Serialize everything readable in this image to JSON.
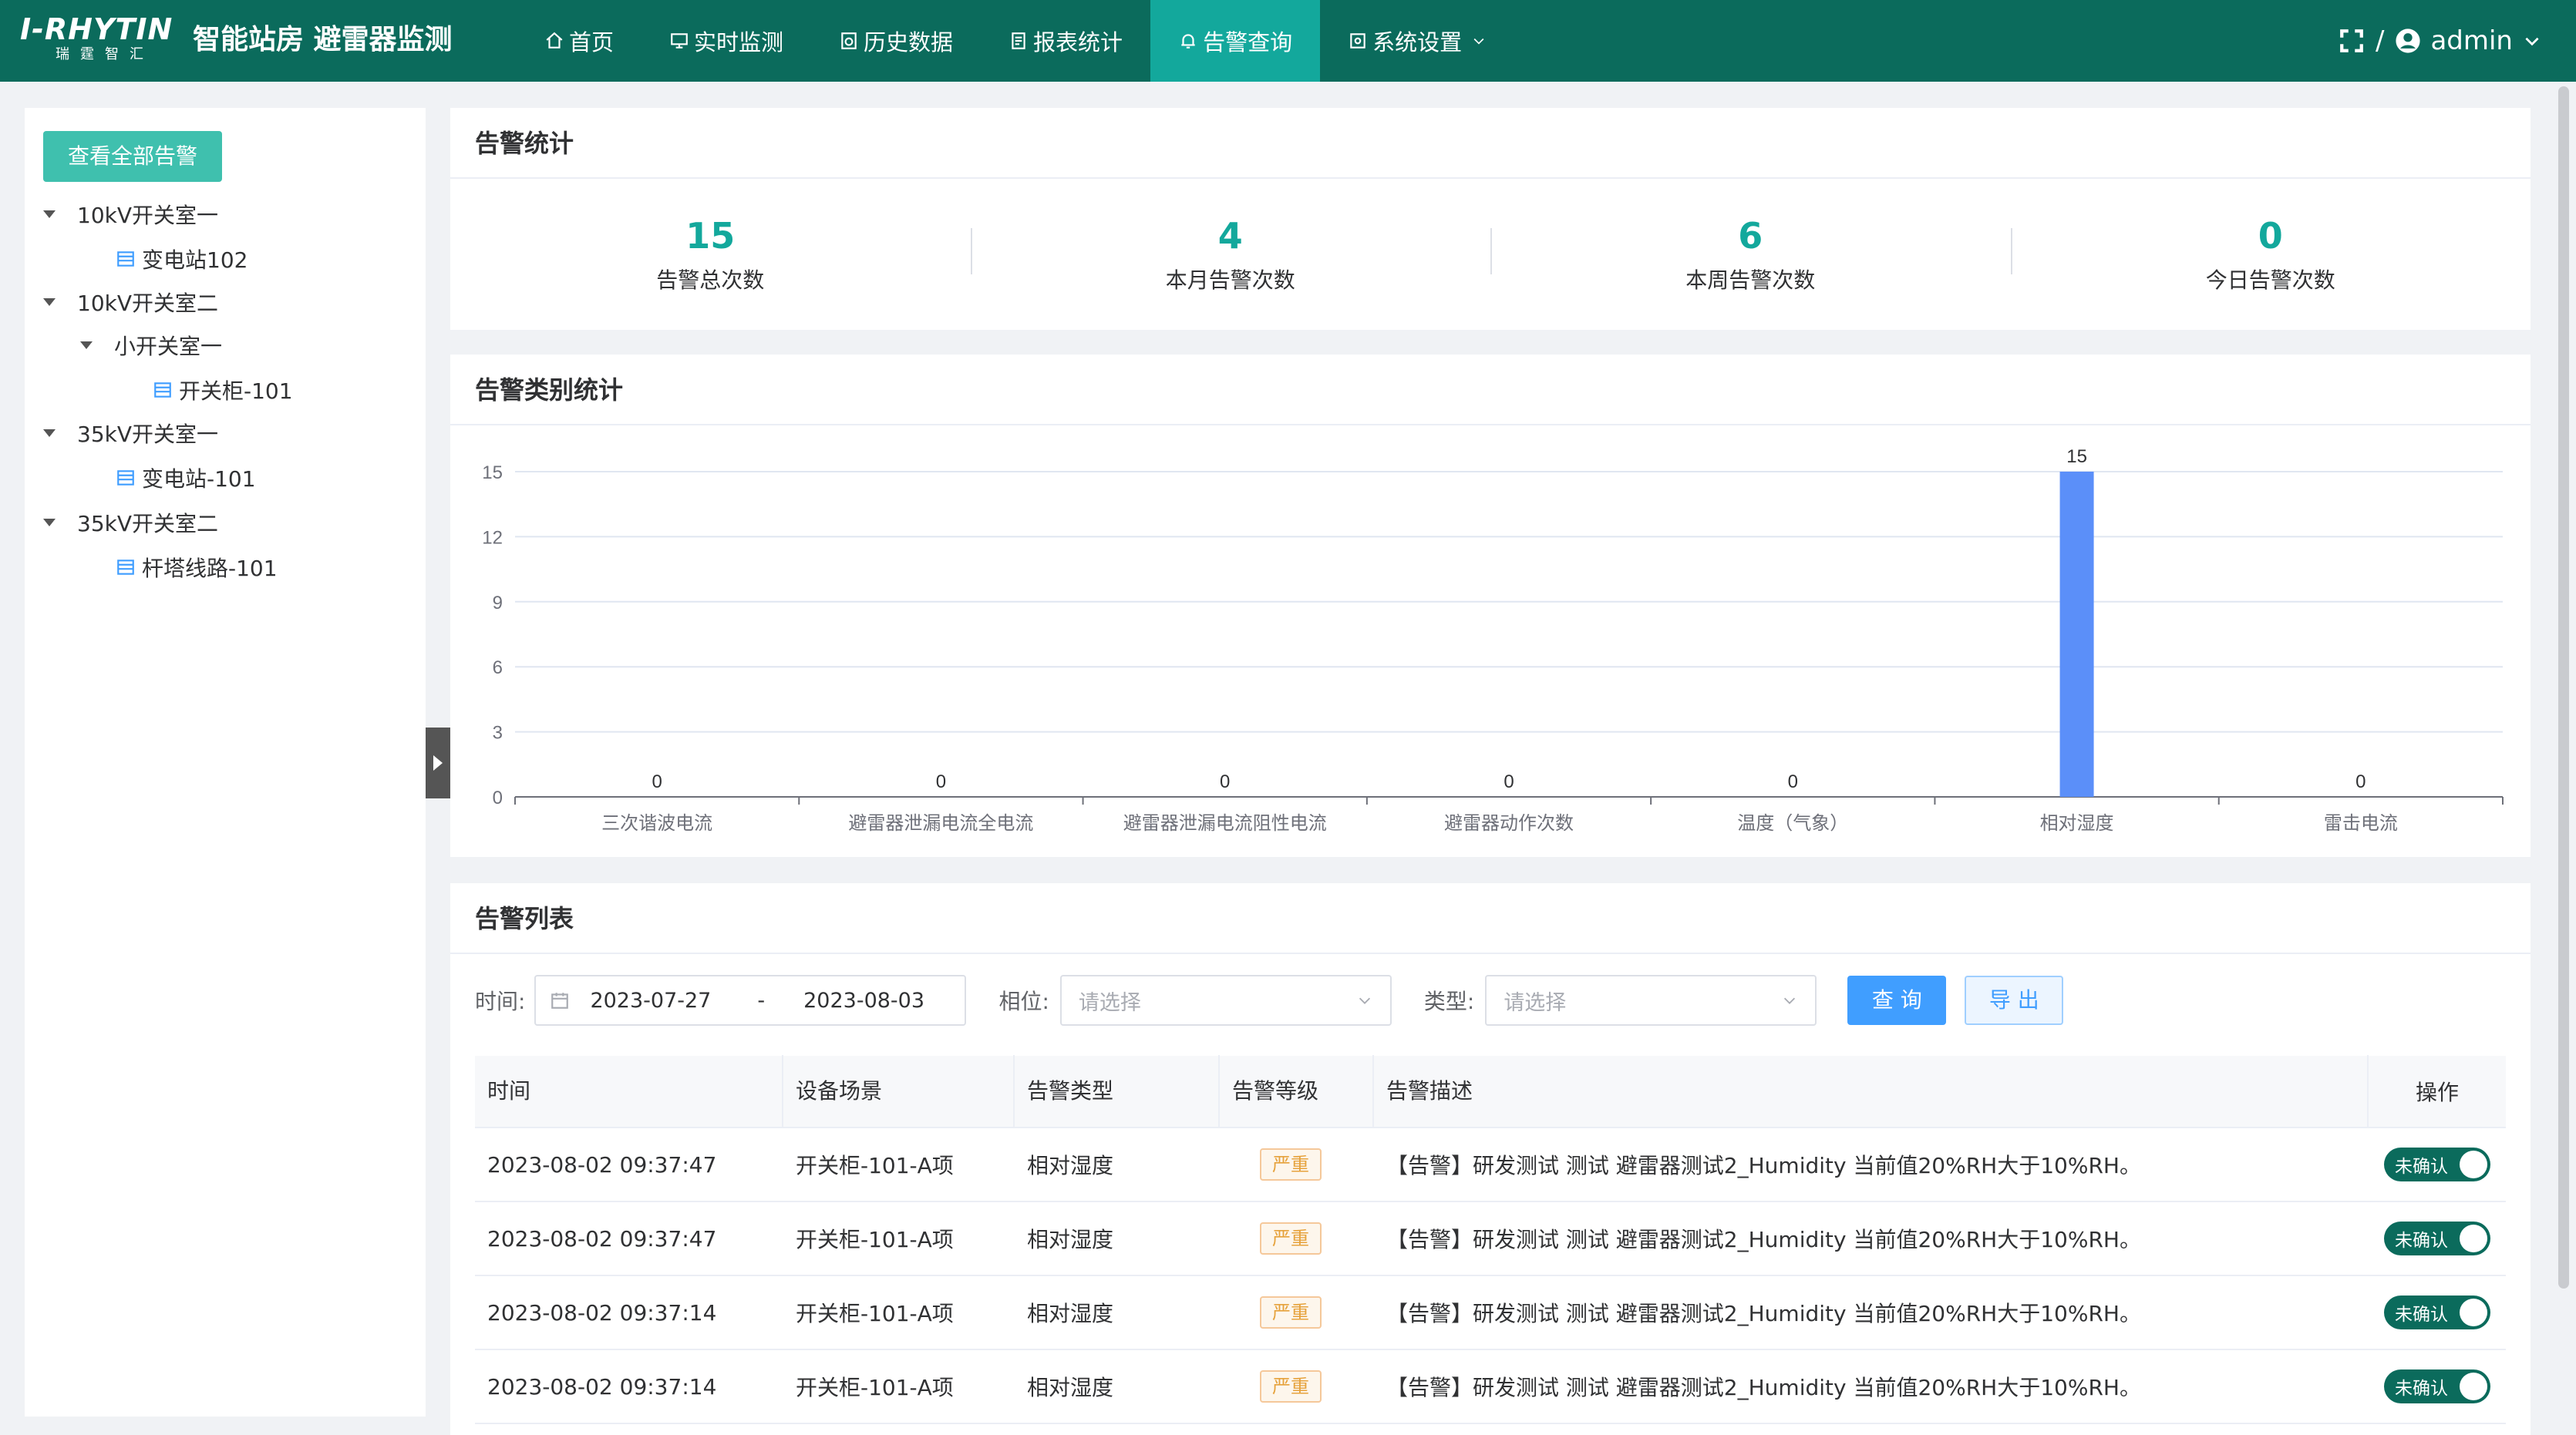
{
  "header": {
    "logo_text": "I-RHYTIN",
    "logo_sub": "瑞霆智汇",
    "app_title": "智能站房  避雷器监测",
    "nav": [
      {
        "label": "首页",
        "icon": "home-icon"
      },
      {
        "label": "实时监测",
        "icon": "monitor-icon"
      },
      {
        "label": "历史数据",
        "icon": "history-icon"
      },
      {
        "label": "报表统计",
        "icon": "report-icon"
      },
      {
        "label": "告警查询",
        "icon": "bell-icon",
        "active": true
      },
      {
        "label": "系统设置",
        "icon": "settings-icon"
      }
    ],
    "separator": "/",
    "user": "admin"
  },
  "sidebar": {
    "view_all_label": "查看全部告警",
    "tree": [
      {
        "label": "10kV开关室一"
      },
      {
        "label": "变电站102"
      },
      {
        "label": "10kV开关室二"
      },
      {
        "label": "小开关室一"
      },
      {
        "label": "开关柜-101"
      },
      {
        "label": "35kV开关室一"
      },
      {
        "label": "变电站-101"
      },
      {
        "label": "35kV开关室二"
      },
      {
        "label": "杆塔线路-101"
      }
    ]
  },
  "stats_card": {
    "title": "告警统计",
    "items": [
      {
        "value": "15",
        "label": "告警总次数"
      },
      {
        "value": "4",
        "label": "本月告警次数"
      },
      {
        "value": "6",
        "label": "本周告警次数"
      },
      {
        "value": "0",
        "label": "今日告警次数"
      }
    ]
  },
  "chart_card": {
    "title": "告警类别统计"
  },
  "chart_data": {
    "type": "bar",
    "categories": [
      "三次谐波电流",
      "避雷器泄漏电流全电流",
      "避雷器泄漏电流阻性电流",
      "避雷器动作次数",
      "温度（气象）",
      "相对湿度",
      "雷击电流"
    ],
    "values": [
      0,
      0,
      0,
      0,
      0,
      15,
      0
    ],
    "ylim": [
      0,
      15
    ],
    "yticks": [
      0,
      3,
      6,
      9,
      12,
      15
    ],
    "grid": true,
    "bar_color": "#5b8ff9",
    "data_labels": true
  },
  "list_card": {
    "title": "告警列表",
    "filters": {
      "time_label": "时间:",
      "date_start": "2023-07-27",
      "date_sep": "-",
      "date_end": "2023-08-03",
      "phase_label": "相位:",
      "phase_placeholder": "请选择",
      "type_label": "类型:",
      "type_placeholder": "请选择",
      "query_label": "查 询",
      "export_label": "导 出"
    },
    "columns": [
      "时间",
      "设备场景",
      "告警类型",
      "告警等级",
      "告警描述",
      "操作"
    ],
    "rows": [
      {
        "time": "2023-08-02 09:37:47",
        "device": "开关柜-101-A项",
        "type": "相对湿度",
        "level": "严重",
        "desc": "【告警】研发测试 测试 避雷器测试2_Humidity 当前值20%RH大于10%RH。",
        "action": "未确认"
      },
      {
        "time": "2023-08-02 09:37:47",
        "device": "开关柜-101-A项",
        "type": "相对湿度",
        "level": "严重",
        "desc": "【告警】研发测试 测试 避雷器测试2_Humidity 当前值20%RH大于10%RH。",
        "action": "未确认"
      },
      {
        "time": "2023-08-02 09:37:14",
        "device": "开关柜-101-A项",
        "type": "相对湿度",
        "level": "严重",
        "desc": "【告警】研发测试 测试 避雷器测试2_Humidity 当前值20%RH大于10%RH。",
        "action": "未确认"
      },
      {
        "time": "2023-08-02 09:37:14",
        "device": "开关柜-101-A项",
        "type": "相对湿度",
        "level": "严重",
        "desc": "【告警】研发测试 测试 避雷器测试2_Humidity 当前值20%RH大于10%RH。",
        "action": "未确认"
      }
    ]
  },
  "colors": {
    "header_bg": "#0b6b5c",
    "nav_active": "#13a89c",
    "accent": "#13a89c",
    "primary_button": "#409eff",
    "warning_tag": "#e6a23c"
  }
}
